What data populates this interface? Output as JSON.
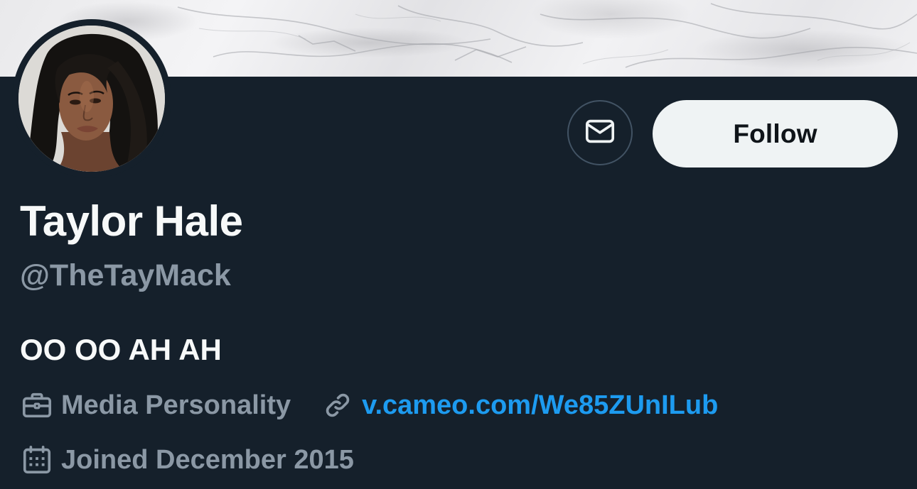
{
  "profile": {
    "display_name": "Taylor Hale",
    "handle": "@TheTayMack",
    "bio": "OO OO AH AH",
    "profession": "Media Personality",
    "website": "v.cameo.com/We85ZUnILub",
    "joined": "Joined December 2015"
  },
  "actions": {
    "follow_label": "Follow"
  },
  "colors": {
    "background": "#15202b",
    "primary_text": "#f7f9f9",
    "secondary_text": "#8b98a5",
    "link": "#1d9bf0",
    "follow_bg": "#eff3f4"
  },
  "icons": {
    "message": "envelope-icon",
    "profession": "briefcase-icon",
    "website": "link-icon",
    "joined": "calendar-icon"
  }
}
